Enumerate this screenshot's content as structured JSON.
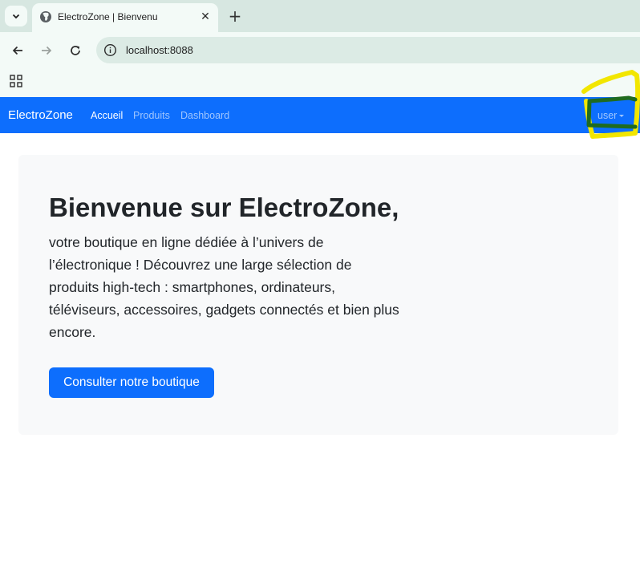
{
  "browser": {
    "tab_title": "ElectroZone | Bienvenu",
    "url": "localhost:8088",
    "icons": {
      "tab_search": "chevron-down-icon",
      "favicon": "globe-icon",
      "close": "close-icon",
      "new_tab": "plus-icon",
      "back": "arrow-left-icon",
      "forward": "arrow-right-icon",
      "reload": "reload-icon",
      "site_info": "info-icon",
      "apps": "apps-grid-icon"
    },
    "close_glyph": "✕",
    "new_tab_glyph": "+"
  },
  "navbar": {
    "brand": "ElectroZone",
    "links": [
      {
        "label": "Accueil",
        "active": true
      },
      {
        "label": "Produits",
        "active": false
      },
      {
        "label": "Dashboard",
        "active": false
      }
    ],
    "user_label": "user",
    "bg_color": "#0d6efd"
  },
  "hero": {
    "title": "Bienvenue sur ElectroZone,",
    "text": "votre boutique en ligne dédiée à l’univers de l’électronique ! Découvrez une large sélection de produits high-tech : smartphones, ordinateurs, téléviseurs, accessoires, gadgets connectés et bien plus encore.",
    "button_label": "Consulter notre boutique"
  },
  "colors": {
    "primary": "#0d6efd",
    "hero_bg": "#f8f9fa",
    "annotation_yellow": "#f2e600",
    "annotation_green": "#1f6b1f"
  }
}
